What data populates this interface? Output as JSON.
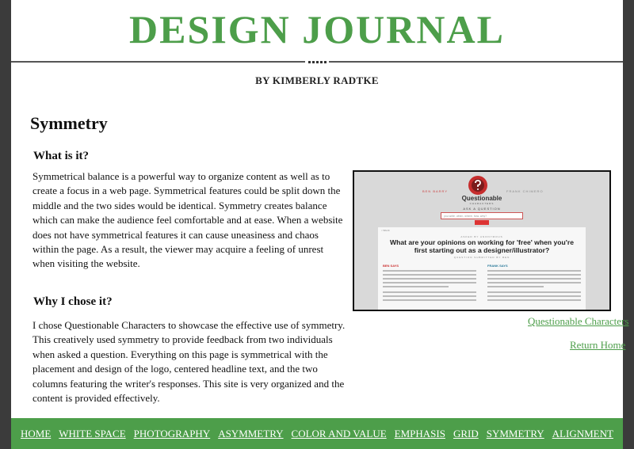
{
  "header": {
    "site_title": "DESIGN JOURNAL",
    "byline": "BY KIMBERLY RADTKE"
  },
  "main": {
    "page_title": "Symmetry",
    "what_heading": "What is it?",
    "what_text": "Symmetrical balance is a powerful way to organize content as well as to create a focus in a web page. Symmetrical features could be split down the middle and the two sides would be identical. Symmetry creates balance which can make the audience feel comfortable and at ease. When a website does not have symmetrical features it can cause uneasiness and chaos within the page. As a result, the viewer may acquire a feeling of unrest when visiting the website.",
    "why_heading": "Why I chose it?",
    "why_text": "I chose Questionable Characters to showcase the effective use of symmetry. This creatively used symmetry to provide feedback from two individuals when asked a question. Everything on this page is symmetrical with the placement and design of the logo, centered headline text, and the two columns featuring the writer's responses. This site is very organized and the content is provided effectively."
  },
  "example": {
    "caption_link": "Questionable Characters",
    "return_link": "Return Home",
    "screenshot": {
      "tagline_left": "BEN BARRY",
      "tagline_right": "FRANK CHIMERO",
      "logo_text": "Questionable",
      "logo_sub": "CHARACTERS",
      "ask_label": "ASK A QUESTION",
      "search_placeholder": "you write, when, where, how, why?",
      "back_label": "< BACK",
      "meta_label": "ASKED BY ANONYMOUS",
      "headline": "What are your opinions on working for 'free' when you're first starting out as a designer/illustrator?",
      "submitted_label": "QUESTION SUBMITTED BY BEN",
      "left_name": "BEN SAYS",
      "right_name": "FRANK SAYS"
    }
  },
  "nav": {
    "items": [
      "HOME",
      "WHITE SPACE",
      "PHOTOGRAPHY",
      "ASYMMETRY",
      "COLOR AND VALUE",
      "EMPHASIS",
      "GRID",
      "SYMMETRY",
      "ALIGNMENT"
    ]
  },
  "colors": {
    "accent_green": "#4d9e4a",
    "outer_background": "#3b3b3b"
  }
}
